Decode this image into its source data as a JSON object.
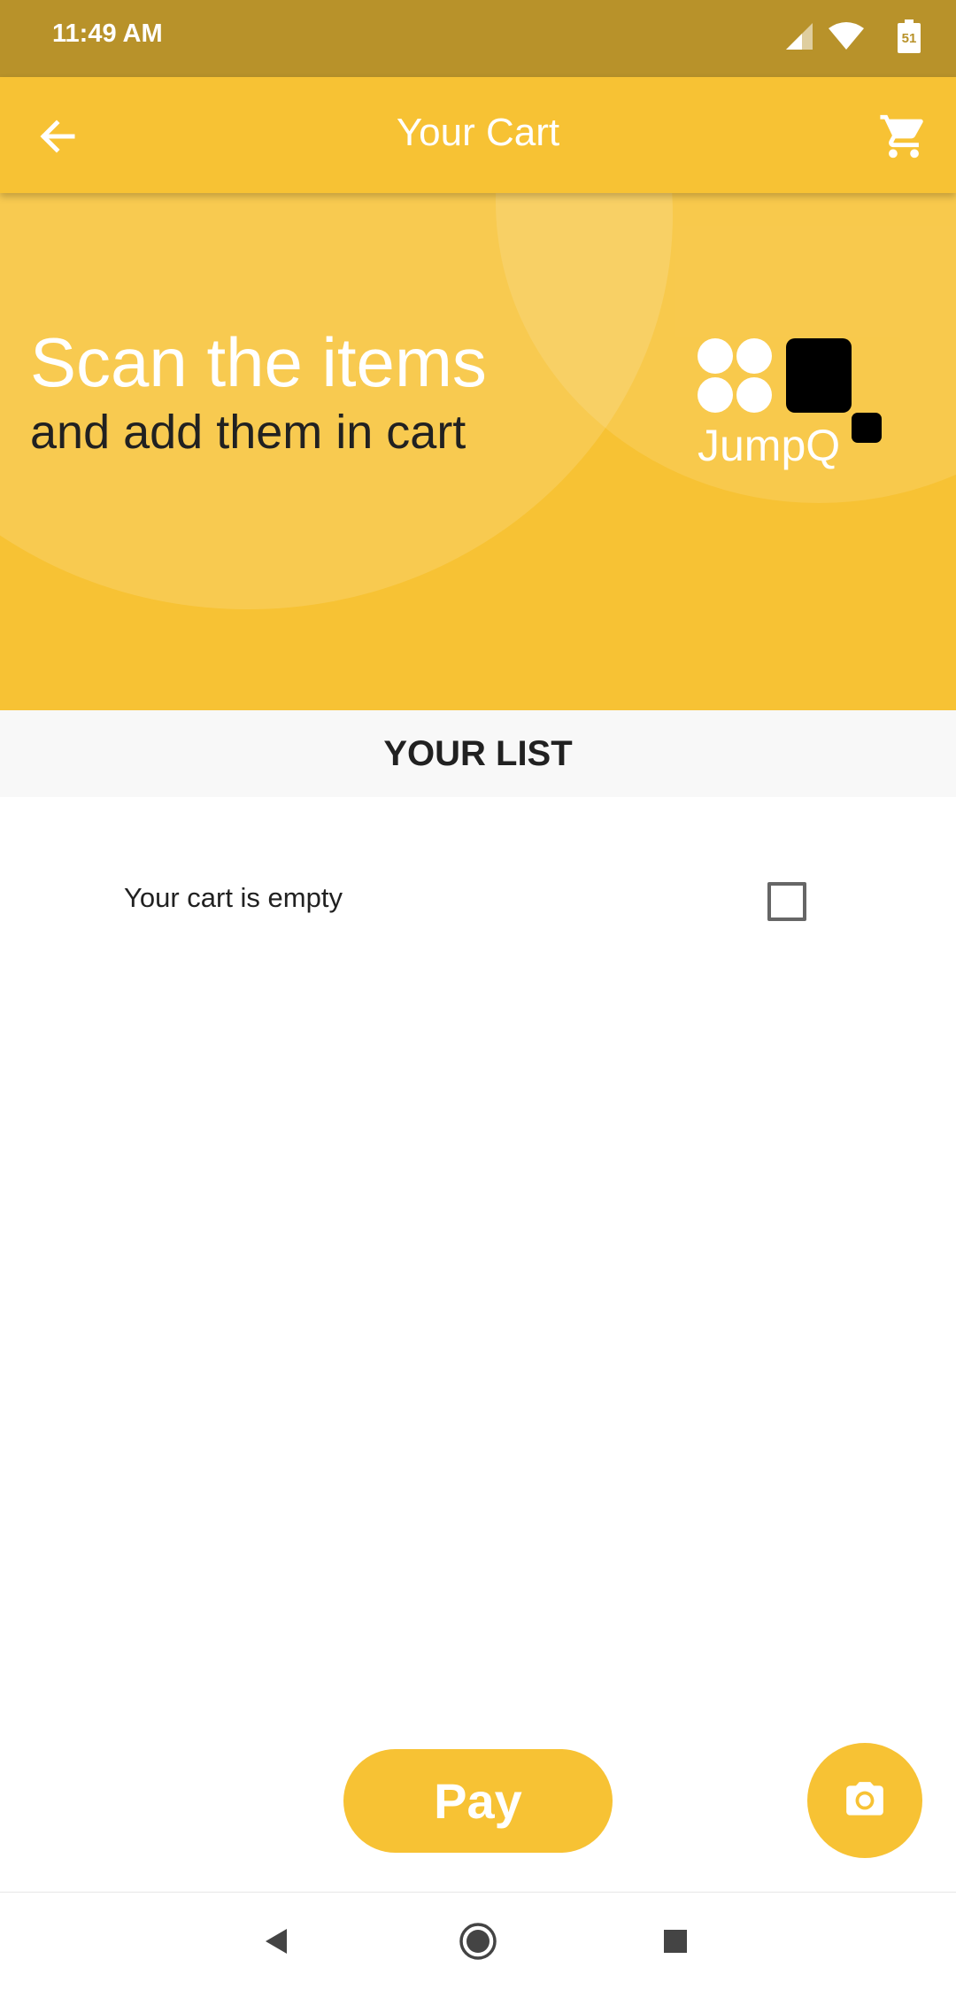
{
  "status_bar": {
    "time": "11:49 AM",
    "battery": "51",
    "icons": [
      "signal-icon",
      "wifi-icon",
      "battery-icon"
    ]
  },
  "app_bar": {
    "title": "Your Cart",
    "back_icon": "back-arrow-icon",
    "cart_icon": "cart-icon"
  },
  "hero": {
    "headline": "Scan the items",
    "subheadline": "and add them in cart",
    "logo_text": "JumpQ"
  },
  "list": {
    "header": "YOUR LIST",
    "empty_message": "Your cart is empty",
    "checkbox_checked": false
  },
  "actions": {
    "pay_label": "Pay",
    "camera_icon": "camera-icon"
  },
  "nav": {
    "items": [
      "back-triangle-icon",
      "home-circle-icon",
      "recents-square-icon"
    ]
  },
  "colors": {
    "accent": "#f7c234",
    "status_bar": "#b8922a",
    "text_dark": "#212121"
  }
}
